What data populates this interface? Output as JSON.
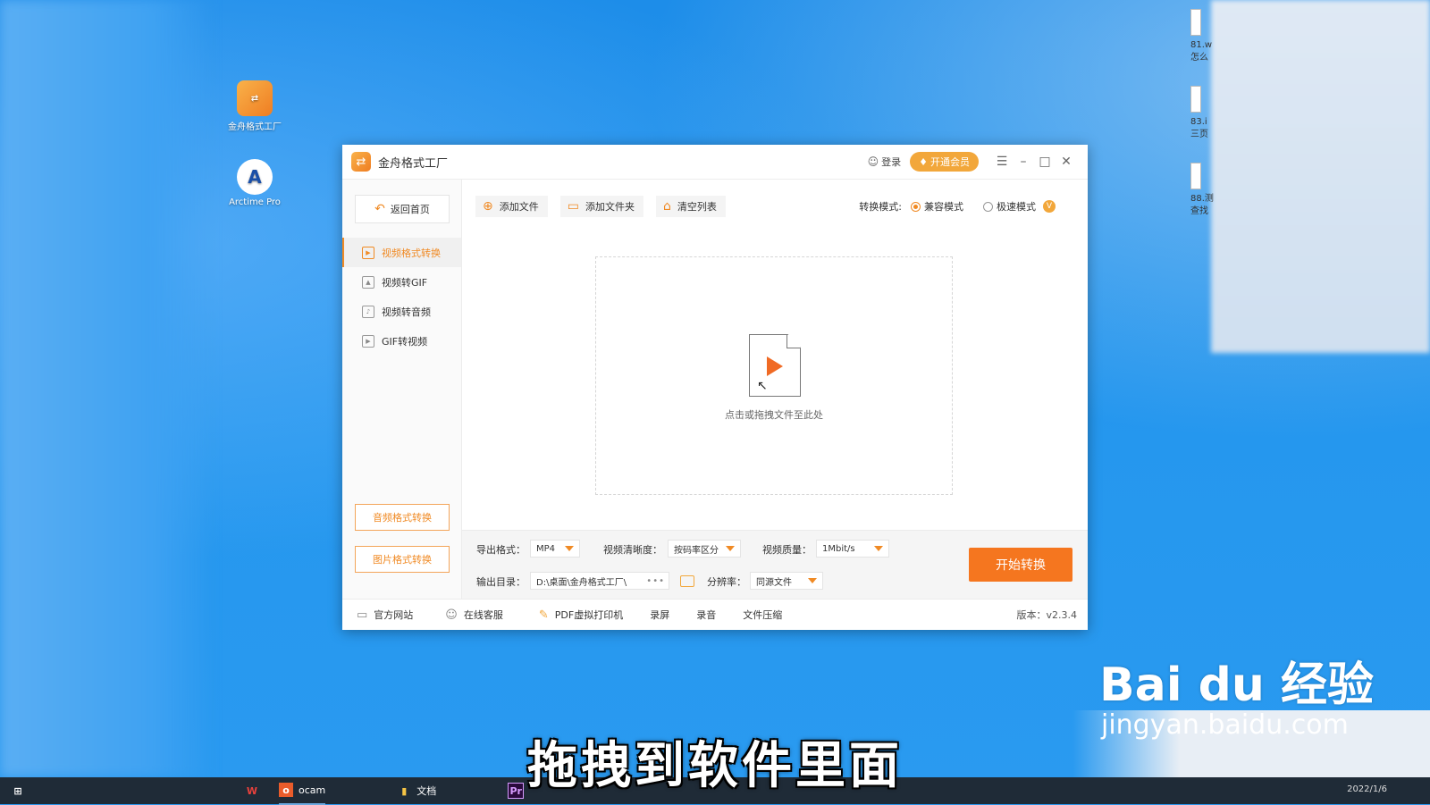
{
  "desktop": {
    "icons": [
      {
        "label": "金舟格式工厂",
        "icon": "converter-app-icon"
      },
      {
        "label": "Arctime Pro",
        "icon": "arctime-icon"
      }
    ],
    "right_files": [
      "81.w",
      "怎么",
      "83.i",
      "三页",
      "88.测",
      "查找"
    ]
  },
  "window": {
    "title": "金舟格式工厂",
    "login": "登录",
    "vip": "开通会员",
    "back": "返回首页",
    "nav": [
      "视频格式转换",
      "视频转GIF",
      "视频转音频",
      "GIF转视频"
    ],
    "side_buttons": [
      "音频格式转换",
      "图片格式转换"
    ],
    "toolbar": [
      "添加文件",
      "添加文件夹",
      "清空列表"
    ],
    "mode_label": "转换模式:",
    "modes": [
      "兼容模式",
      "极速模式"
    ],
    "mode_badge": "V",
    "drop_text": "点击或拖拽文件至此处",
    "settings": {
      "format_label": "导出格式：",
      "format_value": "MP4",
      "clarity_label": "视频清晰度：",
      "clarity_value": "按码率区分",
      "quality_label": "视频质量：",
      "quality_value": "1Mbit/s",
      "output_label": "输出目录：",
      "output_value": "D:\\桌面\\金舟格式工厂\\",
      "output_dots": "•••",
      "resolution_label": "分辨率：",
      "resolution_value": "同源文件",
      "start": "开始转换"
    },
    "footer": [
      "官方网站",
      "在线客服",
      "PDF虚拟打印机",
      "录屏",
      "录音",
      "文件压缩"
    ],
    "version": "版本：v2.3.4"
  },
  "taskbar": {
    "items": [
      "ocam",
      "文档"
    ],
    "clock": "2022/1/6"
  },
  "overlay": {
    "subtitle": "拖拽到软件里面",
    "watermark_brand": "Bai du 经验",
    "watermark_url": "jingyan.baidu.com"
  }
}
